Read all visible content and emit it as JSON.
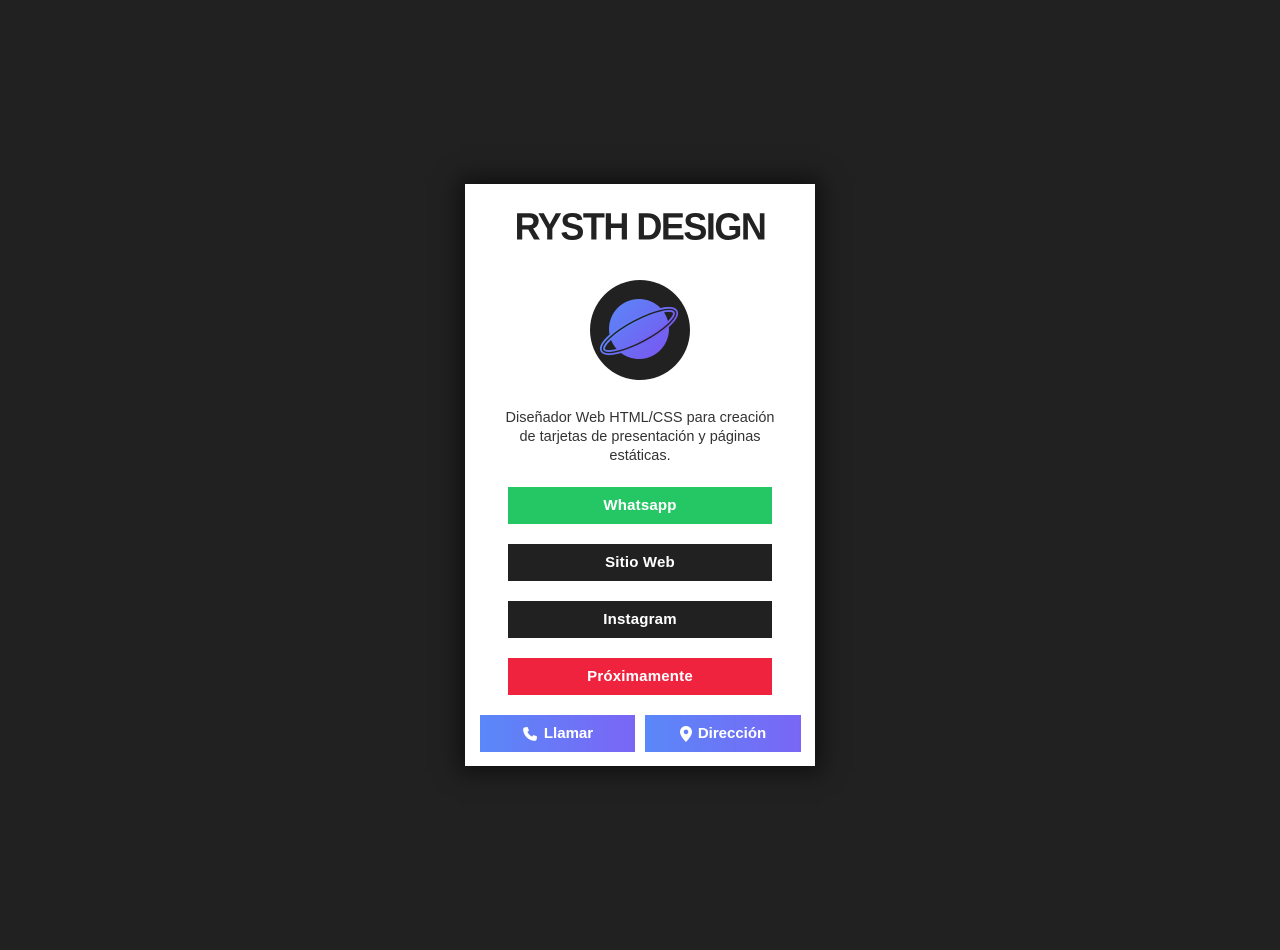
{
  "card": {
    "title": "RYSTH DESIGN",
    "description": "Diseñador Web HTML/CSS para creación de tarjetas de presentación y páginas estáticas."
  },
  "buttons": {
    "whatsapp": "Whatsapp",
    "website": "Sitio Web",
    "instagram": "Instagram",
    "coming_soon": "Próximamente"
  },
  "actions": {
    "call": {
      "label": "Llamar",
      "icon": "phone-icon"
    },
    "directions": {
      "label": "Dirección",
      "icon": "map-pin-icon"
    }
  },
  "colors": {
    "background": "#212121",
    "whatsapp": "#25c764",
    "dark_button": "#212121",
    "coming_soon": "#f0233e",
    "gradient_start": "#5a88f8",
    "gradient_end": "#7a66f5"
  },
  "avatar": {
    "icon": "planet-icon"
  }
}
